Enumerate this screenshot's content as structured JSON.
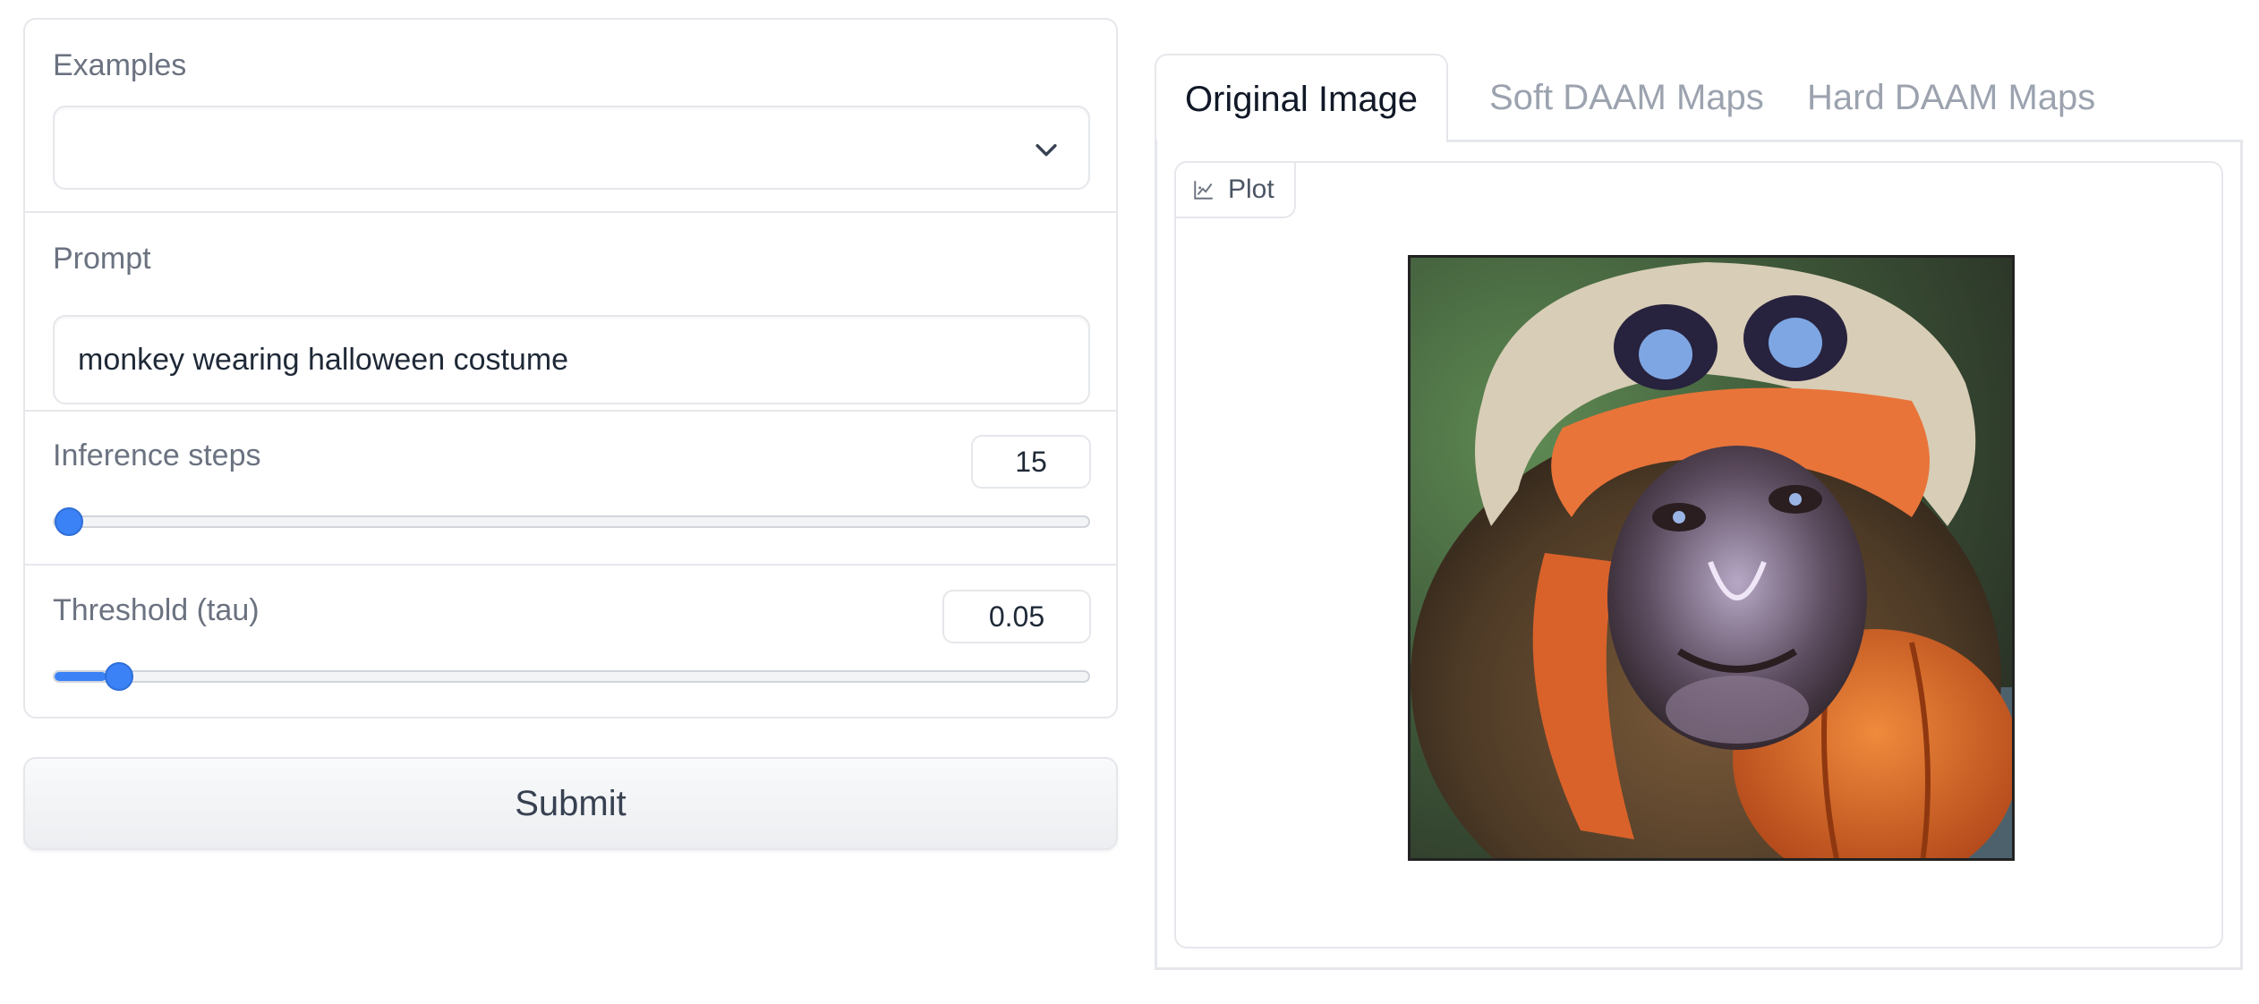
{
  "form": {
    "examples": {
      "label": "Examples",
      "value": ""
    },
    "prompt": {
      "label": "Prompt",
      "value": "monkey wearing halloween costume"
    },
    "inference_steps": {
      "label": "Inference steps",
      "value": "15",
      "fraction": 0.0
    },
    "threshold": {
      "label": "Threshold (tau)",
      "value": "0.05",
      "fraction": 0.05
    },
    "submit_label": "Submit"
  },
  "tabs": [
    {
      "label": "Original Image",
      "active": true
    },
    {
      "label": "Soft DAAM Maps",
      "active": false
    },
    {
      "label": "Hard DAAM Maps",
      "active": false
    }
  ],
  "plot": {
    "label": "Plot"
  },
  "colors": {
    "accent": "#3b82f6",
    "border": "#e5e7eb",
    "label": "#6b7280"
  }
}
